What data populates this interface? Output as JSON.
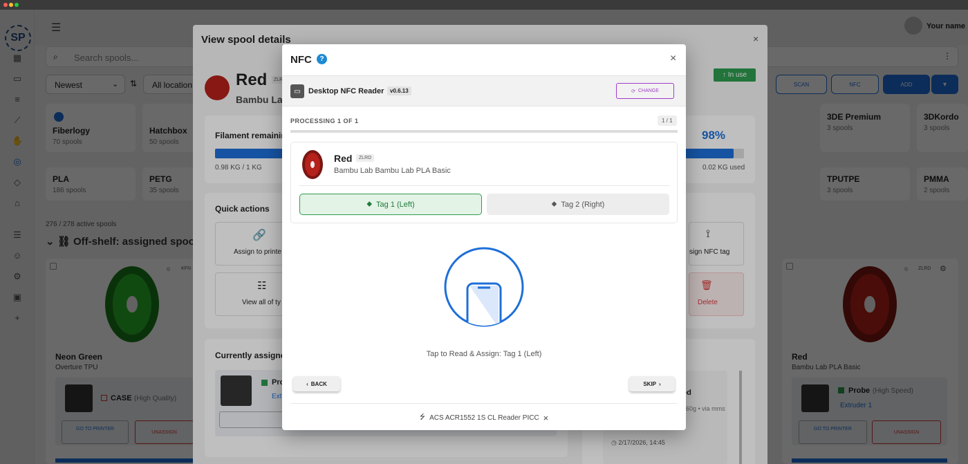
{
  "header": {
    "user_name": "Your name"
  },
  "search": {
    "placeholder": "Search spools..."
  },
  "filters": {
    "sort": "Newest",
    "location": "All location"
  },
  "toolbar": {
    "scan": "SCAN",
    "nfc": "NFC",
    "add": "ADD"
  },
  "brands": [
    {
      "name": "Fiberlogy",
      "count": "70 spools"
    },
    {
      "name": "Hatchbox",
      "count": "50 spools"
    },
    {
      "name": "3DE Premium",
      "count": "3 spools"
    },
    {
      "name": "3DKordo",
      "count": "3 spools"
    }
  ],
  "materials": [
    {
      "name": "PLA",
      "count": "186 spools"
    },
    {
      "name": "PETG",
      "count": "35 spools"
    },
    {
      "name": "TPUTPE",
      "count": "3 spools"
    },
    {
      "name": "PMMA",
      "count": "2 spools"
    }
  ],
  "active_spools": "276 / 278 active spools",
  "section_title": "Off-shelf: assigned spoo",
  "left_spool": {
    "name": "Neon Green",
    "sub": "Overture TPU",
    "code": "KFN",
    "printer": "CASE",
    "printer_note": "(High Quality)",
    "goto": "GO TO PRINTER",
    "unassign": "UNASSIGN"
  },
  "right_spool": {
    "name": "Red",
    "sub": "Bambu Lab PLA Basic",
    "code": "ZLRD",
    "printer": "Probe",
    "printer_note": "(High Speed)",
    "extruder": "Extruder 1",
    "goto": "GO TO PRINTER",
    "unassign": "UNASSIGN"
  },
  "details": {
    "title": "View spool details",
    "spool_name": "Red",
    "spool_code": "ZLR",
    "brand_short": "Bambu La",
    "in_use": "In use",
    "filament_label": "Filament remainin",
    "percent": "98%",
    "remaining_frac": 0.98,
    "weight": "0.98 KG / 1 KG",
    "used": "0.02 KG used",
    "quick_actions": "Quick actions",
    "assign_printer": "Assign to printe",
    "view_all": "View all of ty",
    "assign_nfc": "sign NFC tag",
    "delete": "Delete",
    "currently_assigned": "Currently assigne",
    "assigned_printer": "Pro",
    "assigned_extruder": "Ext",
    "history_title": "ed",
    "history_sub": "960g • via mms",
    "history_time": "2/17/2026, 14:45"
  },
  "nfc": {
    "title": "NFC",
    "help": "?",
    "reader_name": "Desktop NFC Reader",
    "reader_version": "v0.6.13",
    "change": "CHANGE",
    "processing": "PROCESSING 1 OF 1",
    "progress": "1 / 1",
    "progress_frac": 1.0,
    "spool_name": "Red",
    "spool_code": "ZLRD",
    "spool_sub": "Bambu Lab Bambu Lab PLA Basic",
    "tag1": "Tag 1 (Left)",
    "tag2": "Tag 2 (Right)",
    "instruction": "Tap to Read & Assign: Tag 1 (Left)",
    "back": "BACK",
    "skip": "SKIP",
    "device": "ACS ACR1552 1S CL Reader PICC"
  },
  "colors": {
    "accent": "#1e6fd9",
    "nfc_purple": "#a23cc8",
    "success": "#2e9b4f",
    "danger": "#d63a3a",
    "spool_red": "#b5211b",
    "spool_green": "#2ab52a"
  }
}
